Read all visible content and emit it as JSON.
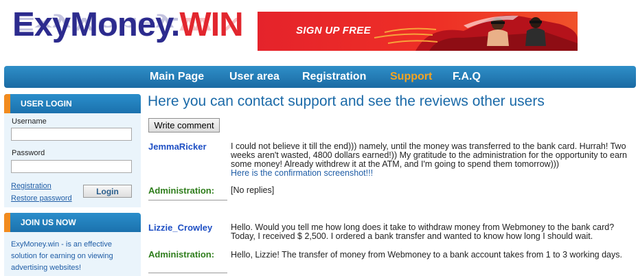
{
  "logo": {
    "part1": "ExyMoney.",
    "part2": "WIN"
  },
  "banner": {
    "signup_label": "SIGN UP FREE"
  },
  "nav": [
    "Main Page",
    "User area",
    "Registration",
    "Support",
    "F.A.Q"
  ],
  "sidebar": {
    "login_title": "USER LOGIN",
    "username_label": "Username",
    "password_label": "Password",
    "registration_link": "Registration",
    "restore_link": "Restore password",
    "login_button": "Login",
    "join_title": "JOIN US NOW",
    "join_text": "ExyMoney.win - is an effective solution for earning on viewing advertising websites!"
  },
  "main": {
    "heading": "Here you can contact support and see the reviews other users",
    "write_button": "Write comment",
    "admin_label": "Administration:",
    "comments": [
      {
        "user": "JemmaRicker",
        "text": "I could not believe it till the end))) namely, until the money was transferred to the bank card. Hurrah! Two weeks aren't wasted, 4800 dollars earned!)) My gratitude to the administration for the opportunity to earn some money! Already withdrew it at the ATM, and I'm going to spend them tomorrow)))",
        "link": "Here is the confirmation screenshot!!!",
        "reply": "[No replies]"
      },
      {
        "user": "Lizzie_Crowley",
        "text": "Hello. Would you tell me how long does it take to withdraw money from Webmoney to the bank card? Today, I received $ 2,500. I ordered a bank transfer and wanted to know how long I should wait.",
        "reply": "Hello, Lizzie! The transfer of money from Webmoney to a bank account takes from 1 to 3 working days."
      }
    ]
  },
  "colors": {
    "brand_blue": "#2c2b8e",
    "brand_red": "#e2262e",
    "nav_active": "#f4a421",
    "nav_bg": "#1f77b4"
  }
}
